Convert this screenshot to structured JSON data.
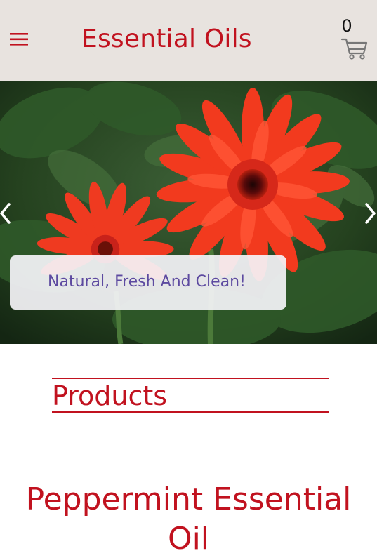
{
  "header": {
    "title": "Essential Oils",
    "menu_icon": "hamburger-icon",
    "cart_count": "0",
    "cart_icon": "cart-icon"
  },
  "hero": {
    "tagline": "Natural, Fresh And Clean!",
    "prev_icon": "chevron-left-icon",
    "next_icon": "chevron-right-icon"
  },
  "products": {
    "heading": "Products",
    "first_product_name": "Peppermint Essential Oil"
  },
  "colors": {
    "brand_red": "#c1121f",
    "header_bg": "#e8e3df",
    "tagline_purple": "#5d4aa0"
  }
}
